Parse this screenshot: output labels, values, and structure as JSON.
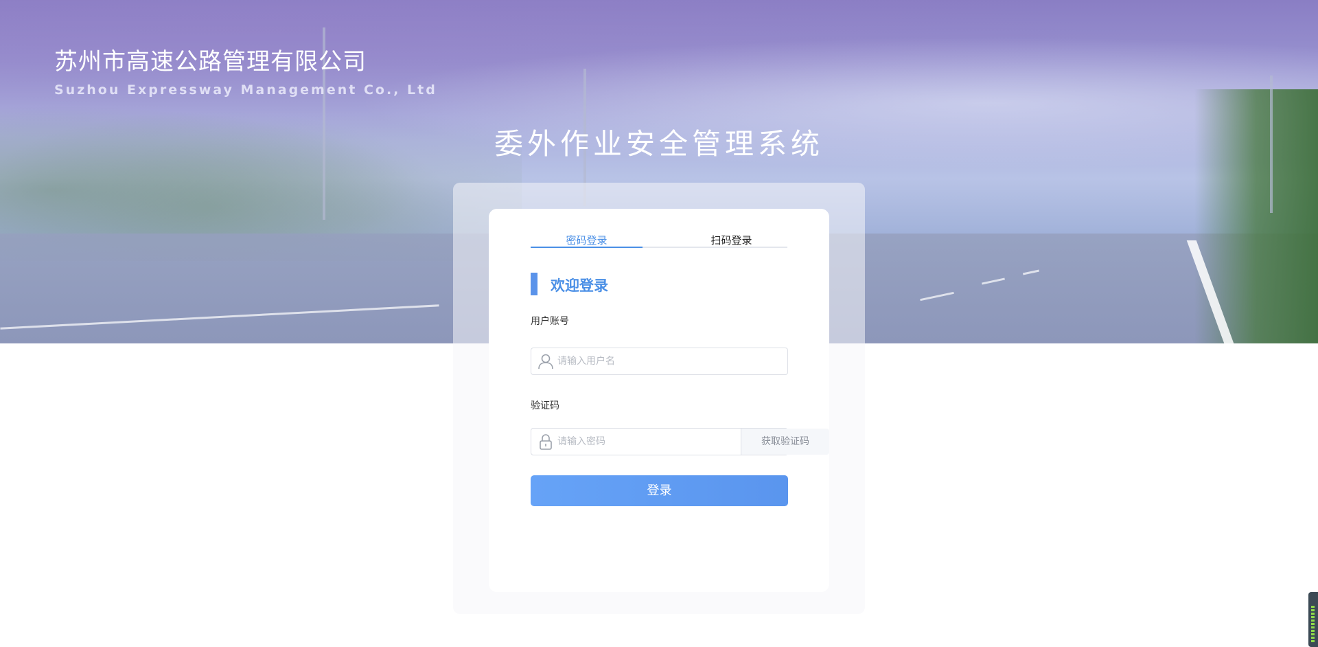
{
  "header": {
    "company_name_cn": "苏州市高速公路管理有限公司",
    "company_name_en": "Suzhou Expressway Management Co., Ltd",
    "system_title": "委外作业安全管理系统"
  },
  "login": {
    "tabs": [
      {
        "label": "密码登录",
        "active": true
      },
      {
        "label": "扫码登录",
        "active": false
      }
    ],
    "welcome": "欢迎登录",
    "username": {
      "label": "用户账号",
      "placeholder": "请输入用户名",
      "value": ""
    },
    "code": {
      "label": "验证码",
      "placeholder": "请输入密码",
      "value": "",
      "get_code_label": "获取验证码"
    },
    "submit_label": "登录"
  },
  "colors": {
    "accent": "#4a8fe6",
    "button": "#66a3f7"
  },
  "icons": {
    "username": "user-icon",
    "code": "lock-icon"
  }
}
